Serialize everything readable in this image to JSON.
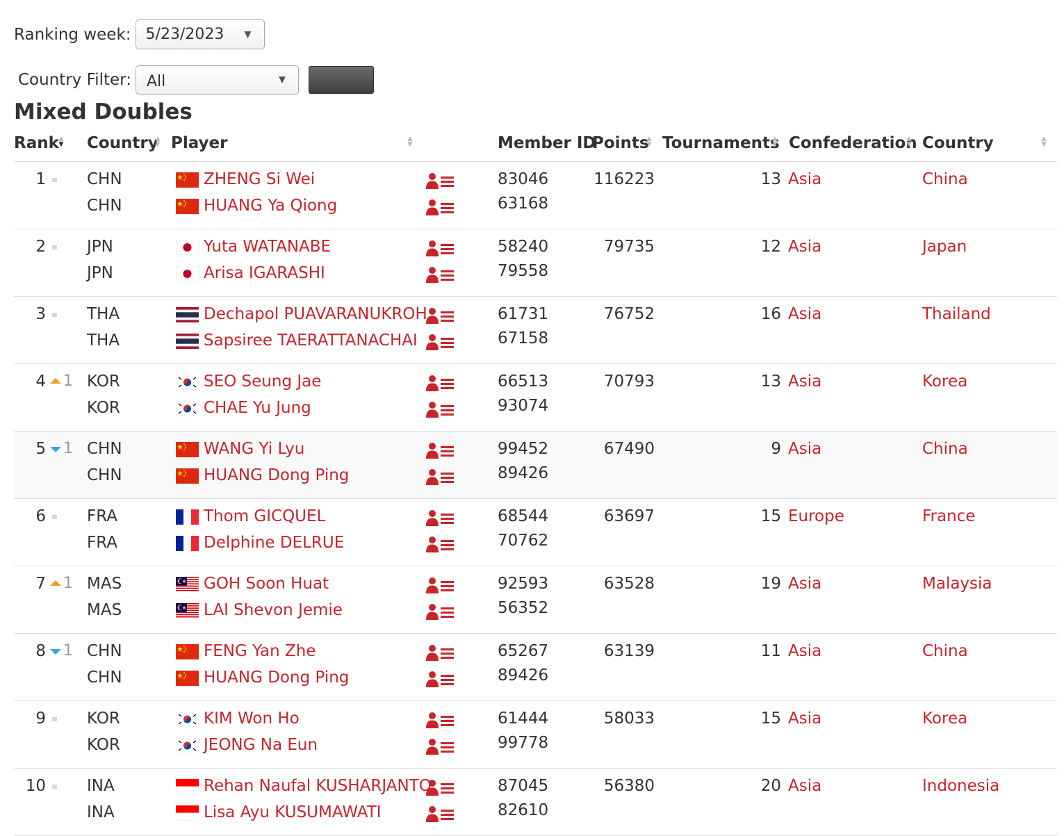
{
  "filters": {
    "week_label": "Ranking week:",
    "week_value": "5/23/2023",
    "country_label": "Country Filter:",
    "country_value": "All"
  },
  "title": "Mixed Doubles",
  "headers": {
    "rank": "Rank",
    "country": "Country",
    "player": "Player",
    "member_id": "Member ID",
    "points": "Points",
    "tournaments": "Tournaments",
    "confederation": "Confederation",
    "country_name": "Country"
  },
  "colors": {
    "link": "#c8242b",
    "up": "#f0a020",
    "down": "#3fa3e0"
  },
  "rows": [
    {
      "rank": "1",
      "change": "none",
      "change_value": "",
      "points": "116223",
      "tournaments": "13",
      "confederation": "Asia",
      "country_name": "China",
      "players": [
        {
          "code": "CHN",
          "flag": "chn",
          "name": "ZHENG Si Wei",
          "member_id": "83046"
        },
        {
          "code": "CHN",
          "flag": "chn",
          "name": "HUANG Ya Qiong",
          "member_id": "63168"
        }
      ]
    },
    {
      "rank": "2",
      "change": "none",
      "change_value": "",
      "points": "79735",
      "tournaments": "12",
      "confederation": "Asia",
      "country_name": "Japan",
      "players": [
        {
          "code": "JPN",
          "flag": "jpn",
          "name": "Yuta WATANABE",
          "member_id": "58240"
        },
        {
          "code": "JPN",
          "flag": "jpn",
          "name": "Arisa IGARASHI",
          "member_id": "79558"
        }
      ]
    },
    {
      "rank": "3",
      "change": "none",
      "change_value": "",
      "points": "76752",
      "tournaments": "16",
      "confederation": "Asia",
      "country_name": "Thailand",
      "players": [
        {
          "code": "THA",
          "flag": "tha",
          "name": "Dechapol PUAVARANUKROH",
          "member_id": "61731"
        },
        {
          "code": "THA",
          "flag": "tha",
          "name": "Sapsiree TAERATTANACHAI",
          "member_id": "67158"
        }
      ]
    },
    {
      "rank": "4",
      "change": "up",
      "change_value": "1",
      "points": "70793",
      "tournaments": "13",
      "confederation": "Asia",
      "country_name": "Korea",
      "players": [
        {
          "code": "KOR",
          "flag": "kor",
          "name": "SEO Seung Jae",
          "member_id": "66513"
        },
        {
          "code": "KOR",
          "flag": "kor",
          "name": "CHAE Yu Jung",
          "member_id": "93074"
        }
      ]
    },
    {
      "rank": "5",
      "change": "down",
      "change_value": "1",
      "points": "67490",
      "tournaments": "9",
      "confederation": "Asia",
      "country_name": "China",
      "players": [
        {
          "code": "CHN",
          "flag": "chn",
          "name": "WANG Yi Lyu",
          "member_id": "99452"
        },
        {
          "code": "CHN",
          "flag": "chn",
          "name": "HUANG Dong Ping",
          "member_id": "89426"
        }
      ]
    },
    {
      "rank": "6",
      "change": "none",
      "change_value": "",
      "points": "63697",
      "tournaments": "15",
      "confederation": "Europe",
      "country_name": "France",
      "players": [
        {
          "code": "FRA",
          "flag": "fra",
          "name": "Thom GICQUEL",
          "member_id": "68544"
        },
        {
          "code": "FRA",
          "flag": "fra",
          "name": "Delphine DELRUE",
          "member_id": "70762"
        }
      ]
    },
    {
      "rank": "7",
      "change": "up",
      "change_value": "1",
      "points": "63528",
      "tournaments": "19",
      "confederation": "Asia",
      "country_name": "Malaysia",
      "players": [
        {
          "code": "MAS",
          "flag": "mas",
          "name": "GOH Soon Huat",
          "member_id": "92593"
        },
        {
          "code": "MAS",
          "flag": "mas",
          "name": "LAI Shevon Jemie",
          "member_id": "56352"
        }
      ]
    },
    {
      "rank": "8",
      "change": "down",
      "change_value": "1",
      "points": "63139",
      "tournaments": "11",
      "confederation": "Asia",
      "country_name": "China",
      "players": [
        {
          "code": "CHN",
          "flag": "chn",
          "name": "FENG Yan Zhe",
          "member_id": "65267"
        },
        {
          "code": "CHN",
          "flag": "chn",
          "name": "HUANG Dong Ping",
          "member_id": "89426"
        }
      ]
    },
    {
      "rank": "9",
      "change": "none",
      "change_value": "",
      "points": "58033",
      "tournaments": "15",
      "confederation": "Asia",
      "country_name": "Korea",
      "players": [
        {
          "code": "KOR",
          "flag": "kor",
          "name": "KIM Won Ho",
          "member_id": "61444"
        },
        {
          "code": "KOR",
          "flag": "kor",
          "name": "JEONG Na Eun",
          "member_id": "99778"
        }
      ]
    },
    {
      "rank": "10",
      "change": "none",
      "change_value": "",
      "points": "56380",
      "tournaments": "20",
      "confederation": "Asia",
      "country_name": "Indonesia",
      "players": [
        {
          "code": "INA",
          "flag": "ina",
          "name": "Rehan Naufal KUSHARJANTO",
          "member_id": "87045"
        },
        {
          "code": "INA",
          "flag": "ina",
          "name": "Lisa Ayu KUSUMAWATI",
          "member_id": "82610"
        }
      ]
    }
  ]
}
